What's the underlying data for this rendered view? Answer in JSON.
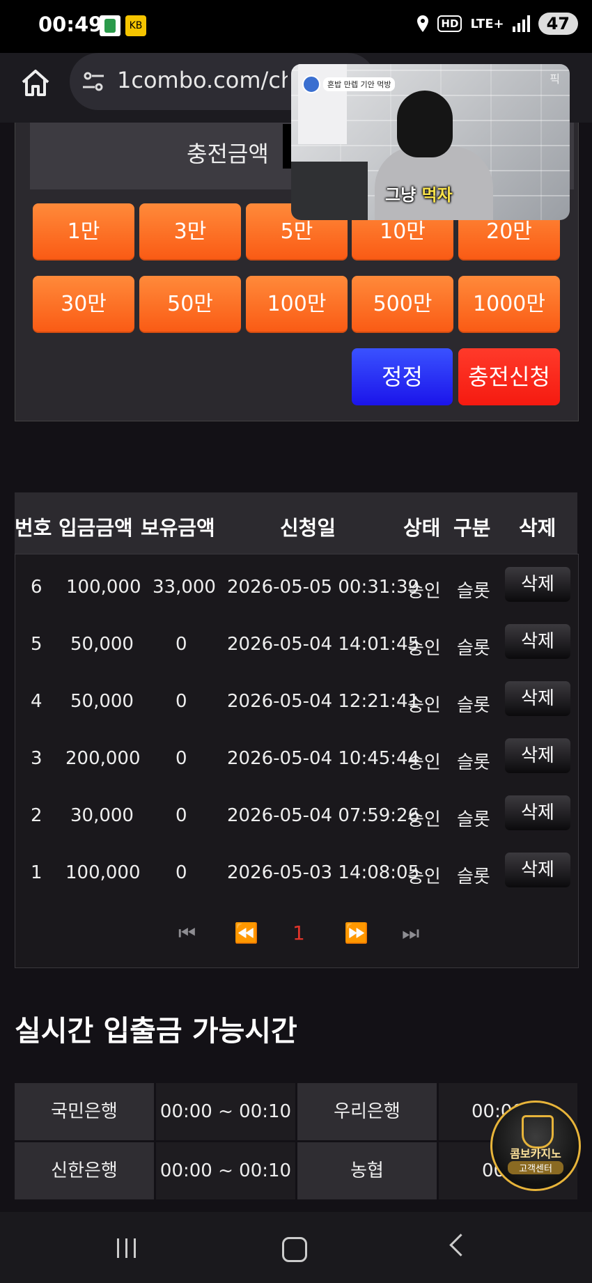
{
  "status_bar": {
    "time": "00:49",
    "hd_label": "HD",
    "network": "LTE+",
    "battery": "47",
    "app_icon_2": "KB"
  },
  "browser": {
    "url": "1combo.com/cha"
  },
  "video_pip": {
    "badge_text": "혼밥 만렙 기안 먹방",
    "caption_part1": "그냥 ",
    "caption_part2": "먹자",
    "corner_text": "픽"
  },
  "charge": {
    "label": "충전금액",
    "amount_buttons": [
      "1만",
      "3만",
      "5만",
      "10만",
      "20만",
      "30만",
      "50만",
      "100만",
      "500만",
      "1000만"
    ],
    "reset_label": "정정",
    "apply_label": "충전신청",
    "colors": {
      "amount": "#fa5a14",
      "reset": "#1b14ea",
      "apply": "#f51a10"
    }
  },
  "history": {
    "headers": {
      "no": "번호",
      "deposit": "입금금액",
      "balance": "보유금액",
      "date": "신청일",
      "status": "상태",
      "type": "구분",
      "delete": "삭제"
    },
    "rows": [
      {
        "no": "6",
        "deposit": "100,000",
        "balance": "33,000",
        "date": "2026-05-05 00:31:39",
        "status": "승인",
        "type": "슬롯",
        "delete": "삭제"
      },
      {
        "no": "5",
        "deposit": "50,000",
        "balance": "0",
        "date": "2026-05-04 14:01:45",
        "status": "승인",
        "type": "슬롯",
        "delete": "삭제"
      },
      {
        "no": "4",
        "deposit": "50,000",
        "balance": "0",
        "date": "2026-05-04 12:21:41",
        "status": "승인",
        "type": "슬롯",
        "delete": "삭제"
      },
      {
        "no": "3",
        "deposit": "200,000",
        "balance": "0",
        "date": "2026-05-04 10:45:44",
        "status": "승인",
        "type": "슬롯",
        "delete": "삭제"
      },
      {
        "no": "2",
        "deposit": "30,000",
        "balance": "0",
        "date": "2026-05-04 07:59:26",
        "status": "승인",
        "type": "슬롯",
        "delete": "삭제"
      },
      {
        "no": "1",
        "deposit": "100,000",
        "balance": "0",
        "date": "2026-05-03 14:08:05",
        "status": "승인",
        "type": "슬롯",
        "delete": "삭제"
      }
    ],
    "pagination": {
      "first": "⏮",
      "prev": "⏪",
      "current": "1",
      "next": "⏩",
      "last": "⏭"
    }
  },
  "realtime": {
    "title": "실시간 입출금 가능시간",
    "banks": [
      {
        "name": "국민은행",
        "hours": "00:00 ~ 00:10"
      },
      {
        "name": "우리은행",
        "hours": "00:00 ~"
      },
      {
        "name": "신한은행",
        "hours": "00:00 ~ 00:10"
      },
      {
        "name": "농협",
        "hours": "00:00"
      }
    ]
  },
  "support_badge": {
    "line1": "콤보카지노",
    "line2": "고객센터"
  }
}
